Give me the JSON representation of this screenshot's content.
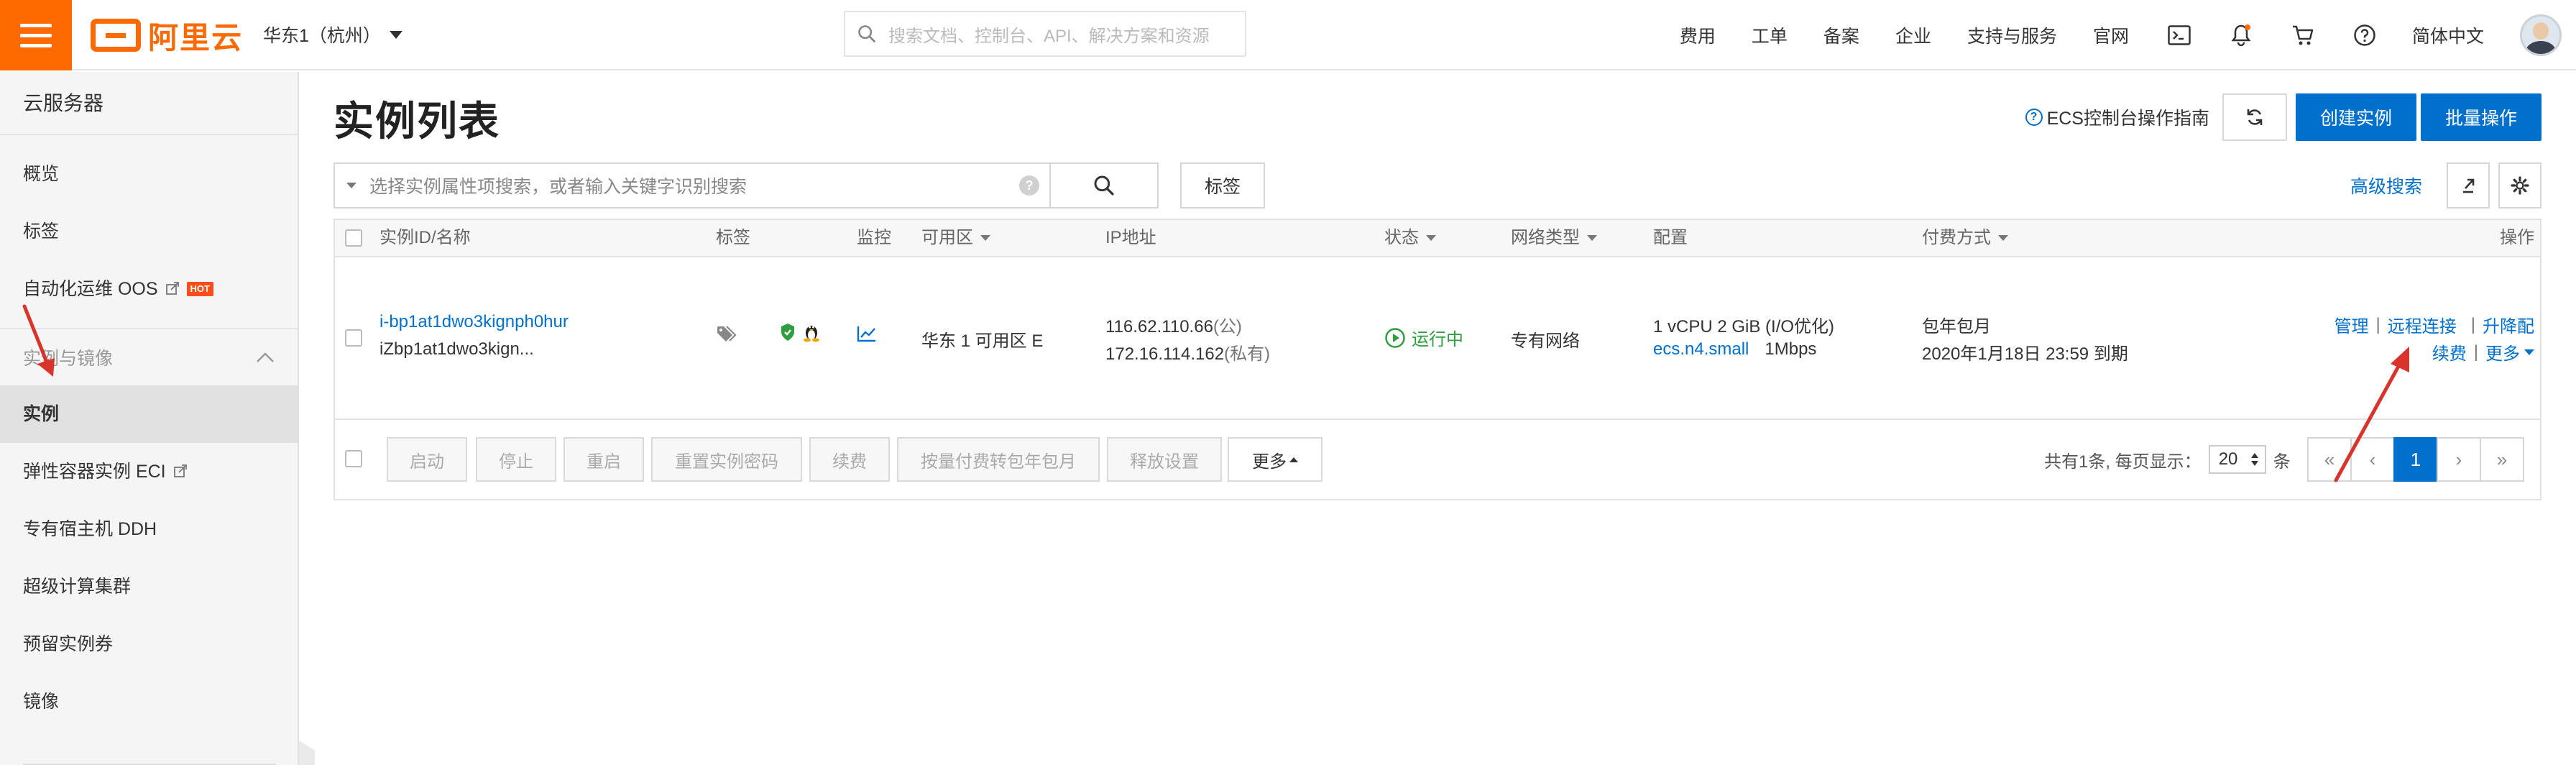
{
  "topbar": {
    "logo_text": "阿里云",
    "region": "华东1（杭州）",
    "search_placeholder": "搜索文档、控制台、API、解决方案和资源",
    "nav": [
      "费用",
      "工单",
      "备案",
      "企业",
      "支持与服务",
      "官网"
    ],
    "language": "简体中文"
  },
  "sidebar": {
    "title": "云服务器",
    "items_top": [
      {
        "label": "概览"
      },
      {
        "label": "标签"
      },
      {
        "label": "自动化运维 OOS",
        "badge": "HOT"
      }
    ],
    "group_label": "实例与镜像",
    "items_group": [
      {
        "label": "实例",
        "active": true
      },
      {
        "label": "弹性容器实例 ECI"
      },
      {
        "label": "专有宿主机 DDH"
      },
      {
        "label": "超级计算集群"
      },
      {
        "label": "预留实例券"
      },
      {
        "label": "镜像"
      }
    ]
  },
  "main": {
    "page_title": "实例列表",
    "guide_link": "ECS控制台操作指南",
    "create_button": "创建实例",
    "batch_button": "批量操作",
    "filter_placeholder": "选择实例属性项搜索，或者输入关键字识别搜索",
    "tag_button": "标签",
    "advanced_search": "高级搜索"
  },
  "table": {
    "columns": [
      "实例ID/名称",
      "标签",
      "监控",
      "可用区",
      "IP地址",
      "状态",
      "网络类型",
      "配置",
      "付费方式",
      "操作"
    ],
    "row": {
      "instance_id": "i-bp1at1dwo3kignph0hur",
      "instance_name": "iZbp1at1dwo3kign...",
      "zone": "华东 1 可用区 E",
      "public_ip": "116.62.110.66",
      "public_suffix": "(公)",
      "private_ip": "172.16.114.162",
      "private_suffix": "(私有)",
      "status": "运行中",
      "network_type": "专有网络",
      "config_spec": "1 vCPU 2 GiB (I/O优化)",
      "config_type": "ecs.n4.small",
      "bandwidth": "1Mbps",
      "billing": "包年包月",
      "expiry": "2020年1月18日 23:59 到期",
      "actions": {
        "manage": "管理",
        "remote": "远程连接",
        "upgrade": "升降配",
        "renew": "续费",
        "more": "更多"
      }
    },
    "batch_actions": [
      "启动",
      "停止",
      "重启",
      "重置实例密码",
      "续费",
      "按量付费转包年包月",
      "释放设置"
    ],
    "more_button": "更多",
    "pager_total": "共有1条, 每页显示：",
    "page_size": "20",
    "page_unit": "条",
    "pages": [
      "«",
      "‹",
      "1",
      "›",
      "»"
    ],
    "current_page": "1"
  },
  "colors": {
    "brand": "#ff6a00",
    "primary": "#0070cc",
    "success": "#2e9e3e",
    "annotation": "#d9342b"
  }
}
